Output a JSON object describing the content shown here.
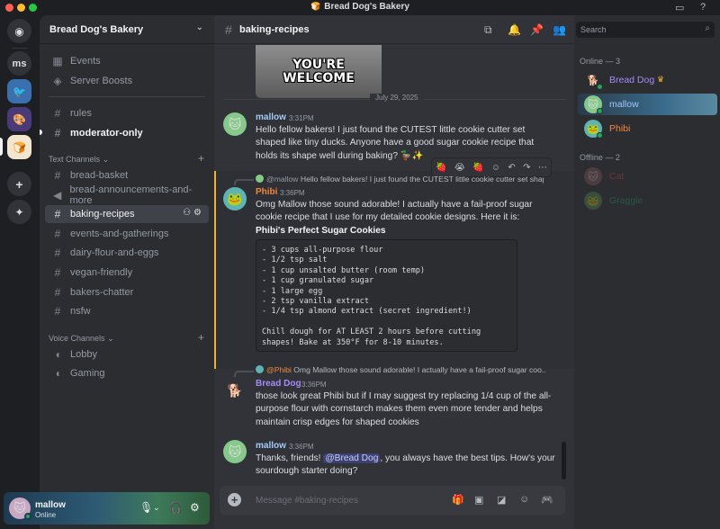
{
  "window": {
    "title": "Bread Dog's Bakery"
  },
  "rail": {
    "servers": [
      {
        "name": "discord-home",
        "label": ""
      },
      {
        "name": "server-ms",
        "label": "ms"
      },
      {
        "name": "server-bird",
        "label": ""
      },
      {
        "name": "server-art",
        "label": ""
      },
      {
        "name": "server-bread",
        "label": ""
      }
    ]
  },
  "sidebar": {
    "guild_name": "Bread Dog's Bakery",
    "top_items": [
      {
        "label": "Events"
      },
      {
        "label": "Server Boosts"
      }
    ],
    "channels_top": [
      {
        "label": "rules"
      },
      {
        "label": "moderator-only"
      }
    ],
    "text_category": "Text Channels",
    "text_channels": [
      {
        "label": "bread-basket"
      },
      {
        "label": "bread-announcements-and-more"
      },
      {
        "label": "baking-recipes"
      },
      {
        "label": "events-and-gatherings"
      },
      {
        "label": "dairy-flour-and-eggs"
      },
      {
        "label": "vegan-friendly"
      },
      {
        "label": "bakers-chatter"
      },
      {
        "label": "nsfw"
      }
    ],
    "voice_category": "Voice Channels",
    "voice_channels": [
      {
        "label": "Lobby"
      },
      {
        "label": "Gaming"
      }
    ]
  },
  "user_panel": {
    "username": "mallow",
    "status": "Online"
  },
  "chat": {
    "channel_name": "baking-recipes",
    "gif_text_1": "YOU'RE",
    "gif_text_2": "WELCOME",
    "date_divider": "July 29, 2025",
    "messages": [
      {
        "author": "mallow",
        "time": "3:31PM",
        "body": "Hello fellow bakers! I just found the CUTEST little cookie cutter set shaped like tiny ducks. Anyone have a good sugar cookie recipe that holds its shape well during baking? 🦆✨"
      },
      {
        "reply_author": "@mallow",
        "reply_text": "Hello fellow bakers! I just found the CUTEST little cookie cutter set shaped like tiny ducks. Anyone have a good sugar cookie recipe that holds its sh...",
        "author": "Phibi",
        "time": "3:36PM",
        "body": "Omg Mallow those sound adorable! I actually have a fail-proof sugar cookie recipe that I use for my detailed cookie designs. Here it is:",
        "recipe_title": "Phibi's Perfect Sugar Cookies",
        "code": "- 3 cups all-purpose flour\n- 1/2 tsp salt\n- 1 cup unsalted butter (room temp)\n- 1 cup granulated sugar\n- 1 large egg\n- 2 tsp vanilla extract\n- 1/4 tsp almond extract (secret ingredient!)\n\nChill dough for AT LEAST 2 hours before cutting\nshapes! Bake at 350°F for 8-10 minutes."
      },
      {
        "reply_author": "@Phibi",
        "reply_text": "Omg Mallow those sound adorable! I actually have a fail-proof sugar coo...",
        "author": "Bread Dog",
        "time": "3:36PM",
        "body": "those look great Phibi but if I may suggest try replacing 1/4 cup of the all-purpose flour with cornstarch makes them even more tender and helps maintain crisp edges for shaped cookies"
      },
      {
        "author": "mallow",
        "time": "3:36PM",
        "body_before": "Thanks, friends! ",
        "mention": "@Bread Dog",
        "body_after": ", you always have the best tips. How's your sourdough starter doing?"
      }
    ],
    "composer_placeholder": "Message #baking-recipes"
  },
  "members": {
    "search_placeholder": "Search",
    "online_header": "Online — 3",
    "online": [
      {
        "name": "Bread Dog",
        "color": "#a78bfa"
      },
      {
        "name": "mallow",
        "color": "#a3c9f7"
      },
      {
        "name": "Phibi",
        "color": "#f0883e"
      }
    ],
    "offline_header": "Offline — 2",
    "offline": [
      {
        "name": "Cat",
        "color": "#f23f43"
      },
      {
        "name": "Graggle",
        "color": "#23a55a"
      }
    ]
  },
  "colors": {
    "accent": "#5865f2",
    "online": "#23a55a",
    "highlight": "#f0b232"
  }
}
